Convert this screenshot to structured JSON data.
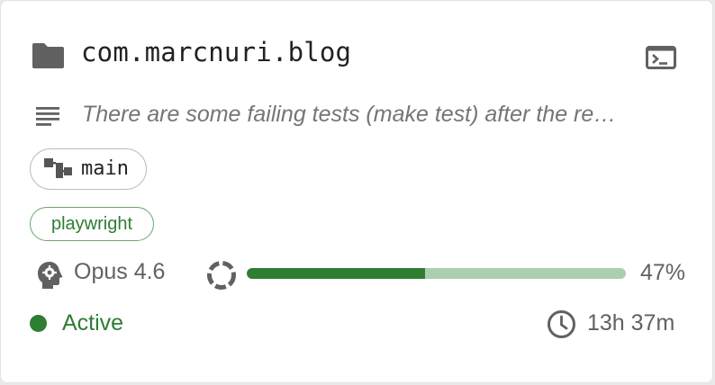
{
  "session": {
    "project": "com.marcnuri.blog",
    "description": "There are some failing tests (make test) after the re…",
    "branch": "main",
    "tag": "playwright",
    "model": "Opus 4.6",
    "context_usage_percent": 47,
    "context_usage_label": "47%",
    "status": "Active",
    "duration": "13h 37m"
  },
  "icons": {
    "project": "folder-icon",
    "terminal": "terminal-icon",
    "description": "notes-icon",
    "branch": "branch-icon",
    "model": "head-gear-icon",
    "usage": "donut-progress-icon",
    "duration": "clock-icon"
  },
  "colors": {
    "accent": "#2e7d32",
    "progress_track": "#acceb0",
    "muted_text": "#616161",
    "icon_gray": "#616161"
  }
}
